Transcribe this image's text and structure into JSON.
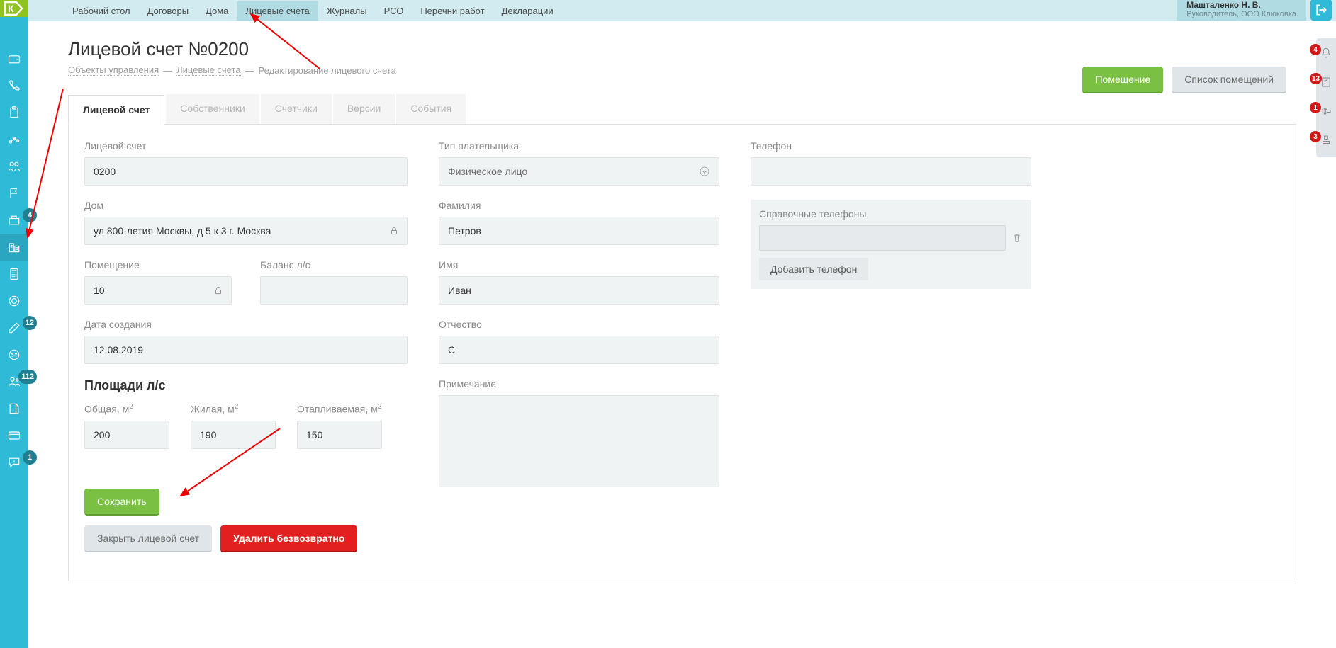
{
  "nav": [
    "Рабочий стол",
    "Договоры",
    "Дома",
    "Лицевые счета",
    "Журналы",
    "РСО",
    "Перечни работ",
    "Декларации"
  ],
  "nav_active_index": 3,
  "user": {
    "name": "Машталенко Н. В.",
    "role": "Руководитель, ООО Клюковка"
  },
  "page": {
    "title": "Лицевой счет №0200",
    "breadcrumbs": [
      "Объекты управления",
      "Лицевые счета",
      "Редактирование лицевого счета"
    ]
  },
  "header_buttons": {
    "room": "Помещение",
    "rooms_list": "Список помещений"
  },
  "tabs": [
    "Лицевой счет",
    "Собственники",
    "Счетчики",
    "Версии",
    "События"
  ],
  "form": {
    "account": {
      "label": "Лицевой счет",
      "value": "0200"
    },
    "house": {
      "label": "Дом",
      "value": "ул 800-летия Москвы, д 5 к 3 г. Москва"
    },
    "room": {
      "label": "Помещение",
      "value": "10"
    },
    "balance": {
      "label": "Баланс л/с",
      "value": ""
    },
    "date": {
      "label": "Дата создания",
      "value": "12.08.2019"
    },
    "payer_type": {
      "label": "Тип плательщика",
      "value": "Физическое лицо"
    },
    "lastname": {
      "label": "Фамилия",
      "value": "Петров"
    },
    "firstname": {
      "label": "Имя",
      "value": "Иван"
    },
    "middlename": {
      "label": "Отчество",
      "value": "С"
    },
    "note": {
      "label": "Примечание",
      "value": ""
    },
    "phone": {
      "label": "Телефон",
      "value": ""
    },
    "ref_phones": {
      "label": "Справочные телефоны",
      "add": "Добавить телефон"
    }
  },
  "areas": {
    "title": "Площади л/с",
    "total": {
      "label": "Общая, м",
      "value": "200"
    },
    "living": {
      "label": "Жилая, м",
      "value": "190"
    },
    "heated": {
      "label": "Отапливаемая, м",
      "value": "150"
    }
  },
  "buttons": {
    "save": "Сохранить",
    "close": "Закрыть лицевой счет",
    "delete": "Удалить безвозвратно"
  },
  "side_badges": {
    "b4": "4",
    "b12": "12",
    "b112": "112",
    "b1": "1"
  },
  "right_badges": {
    "r1": "4",
    "r2": "13",
    "r3": "1",
    "r4": "3"
  }
}
